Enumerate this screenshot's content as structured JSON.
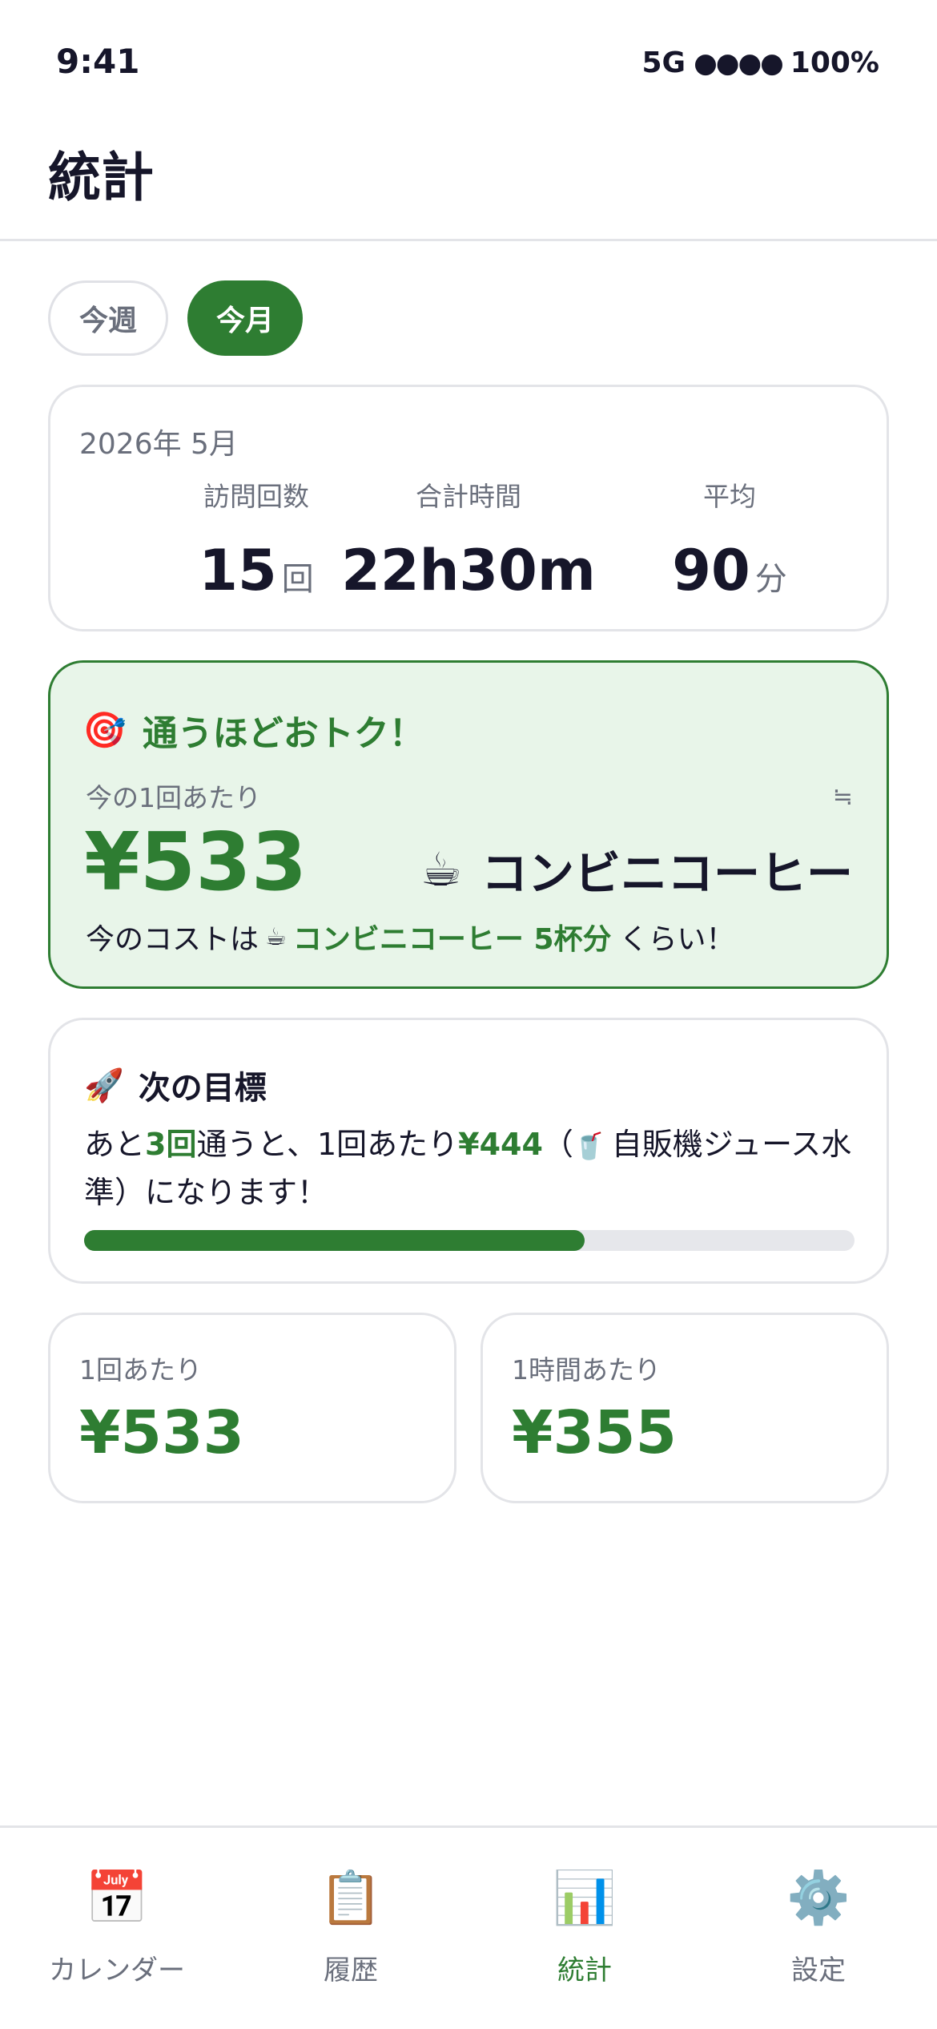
{
  "status_bar": {
    "time": "9:41",
    "network": "5G",
    "signal": "●●●●",
    "battery": "100%"
  },
  "header": {
    "title": "統計"
  },
  "period_tabs": {
    "week": "今週",
    "month": "今月",
    "selected": "今月"
  },
  "summary": {
    "date": "2026年 5月",
    "metrics": [
      {
        "label": "訪問回数",
        "value": "15",
        "unit": "回"
      },
      {
        "label": "合計時間",
        "value": "22h30m",
        "unit": ""
      },
      {
        "label": "平均",
        "value": "90",
        "unit": "分"
      }
    ]
  },
  "deal": {
    "icon": "🎯",
    "title": "通うほどおトク！",
    "subtitle": "今の1回あたり",
    "approx": "≒",
    "price": "¥533",
    "equiv_icon": "☕",
    "equiv_label": "コンビニコーヒー",
    "foot_prefix": "今のコストは",
    "foot_icon": "☕",
    "foot_highlight": "コンビニコーヒー 5杯分",
    "foot_suffix": "くらい！"
  },
  "goal": {
    "icon": "🚀",
    "title": "次の目標",
    "text_1": "あと",
    "visits": "3回",
    "text_2": "通うと、1回あたり",
    "target_price": "¥444",
    "text_3": "（",
    "target_icon": "🥤",
    "text_4": "自販機ジュース水準）になります！",
    "progress": 0.65,
    "accent_color": "#2e7d32"
  },
  "per_visit": {
    "label": "1回あたり",
    "value": "¥533"
  },
  "per_hour": {
    "label": "1時間あたり",
    "value": "¥355"
  },
  "tab_bar": {
    "items": [
      {
        "icon": "📅",
        "label": "カレンダー"
      },
      {
        "icon": "📋",
        "label": "履歴"
      },
      {
        "icon": "📊",
        "label": "統計"
      },
      {
        "icon": "⚙️",
        "label": "設定"
      }
    ],
    "active": "統計"
  }
}
